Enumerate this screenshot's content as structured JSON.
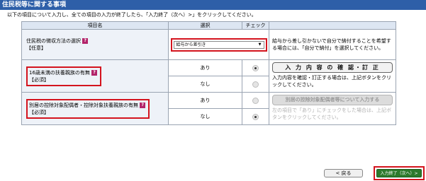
{
  "page": {
    "title": "住民税等に関する事項",
    "instruction": "以下の項目について入力し、全ての項目の入力が終了したら、「入力終了（次へ）>」をクリックしてください。"
  },
  "table": {
    "headers": {
      "item": "項目名",
      "select": "選択",
      "check": "チェック"
    },
    "help_icon": "?",
    "rows": {
      "collection": {
        "label": "住民税の徴収方法の選択",
        "note": "【任意】",
        "select_value": "給与から差引き",
        "description": "給与から差し引かないで自分で納付することを希望する場合には、「自分で納付」を選択してください。"
      },
      "dependents": {
        "label": "16歳未満の扶養親族の有無",
        "note": "【必須】",
        "options": [
          "あり",
          "なし"
        ],
        "checked": "あり",
        "button": "入 力 内 容 の 確 認・訂 正",
        "description": "入力内容を確認・訂正する場合は、上記ボタンをクリックしてください。"
      },
      "separate": {
        "label": "別居の控除対象配偶者・控除対象扶養親族の有無",
        "note": "【必須】",
        "options": [
          "あり",
          "なし"
        ],
        "checked": "なし",
        "button": "別居の控除対象配偶者等について入力する",
        "description": "左の項目で「あり」にチェックをした場合は、上記ボタンをクリックしてください。"
      }
    }
  },
  "footer": {
    "back": "< 戻る",
    "next": "入力終了（次へ）>"
  },
  "colors": {
    "title_bar": "#2e5fa8",
    "highlight": "#d4141e",
    "next_button": "#2d7a2d",
    "help_icon": "#b3246a"
  },
  "icons": [
    "help-icon",
    "dropdown-arrow-icon"
  ]
}
